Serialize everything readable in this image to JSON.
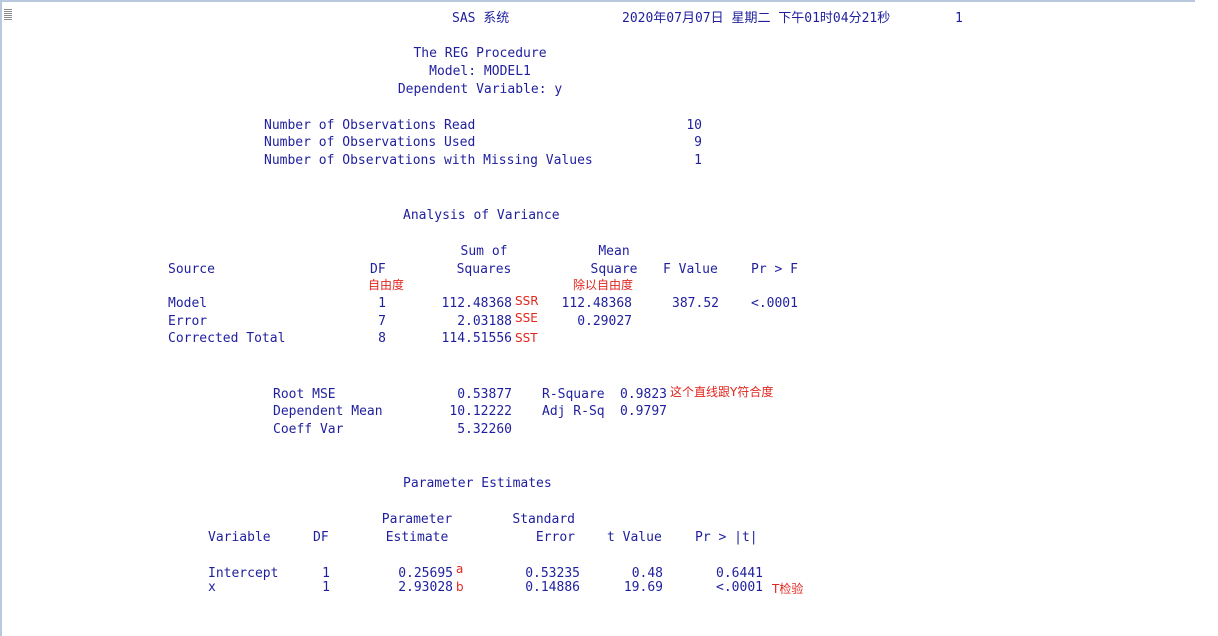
{
  "header": {
    "system_title": "SAS 系统",
    "datetime": "2020年07月07日 星期二 下午01时04分21秒",
    "page_number": "1"
  },
  "procedure": {
    "title": "The REG Procedure",
    "model": "Model: MODEL1",
    "dependent": "Dependent Variable: y"
  },
  "observations": [
    {
      "label": "Number of Observations Read",
      "value": "10"
    },
    {
      "label": "Number of Observations Used",
      "value": "9"
    },
    {
      "label": "Number of Observations with Missing Values",
      "value": "1"
    }
  ],
  "anova": {
    "title": "Analysis of Variance",
    "headers": {
      "source": "Source",
      "df": "DF",
      "ss_top": "Sum of",
      "ss_bottom": "Squares",
      "ms_top": "Mean",
      "ms_bottom": "Square",
      "f": "F Value",
      "p": "Pr > F"
    },
    "rows": [
      {
        "source": "Model",
        "df": "1",
        "ss": "112.48368",
        "ms": "112.48368",
        "f": "387.52",
        "p": "<.0001"
      },
      {
        "source": "Error",
        "df": "7",
        "ss": "2.03188",
        "ms": "0.29027",
        "f": "",
        "p": ""
      },
      {
        "source": "Corrected Total",
        "df": "8",
        "ss": "114.51556",
        "ms": "",
        "f": "",
        "p": ""
      }
    ]
  },
  "fit": {
    "left": [
      {
        "label": "Root MSE",
        "value": "0.53877"
      },
      {
        "label": "Dependent Mean",
        "value": "10.12222"
      },
      {
        "label": "Coeff Var",
        "value": "5.32260"
      }
    ],
    "right": [
      {
        "label": "R-Square",
        "value": "0.9823"
      },
      {
        "label": "Adj R-Sq",
        "value": "0.9797"
      }
    ]
  },
  "params": {
    "title": "Parameter Estimates",
    "headers": {
      "variable": "Variable",
      "df": "DF",
      "est_top": "Parameter",
      "est_bottom": "Estimate",
      "se_top": "Standard",
      "se_bottom": "Error",
      "t": "t Value",
      "p": "Pr > |t|"
    },
    "rows": [
      {
        "variable": "Intercept",
        "df": "1",
        "estimate": "0.25695",
        "se": "0.53235",
        "t": "0.48",
        "p": "0.6441"
      },
      {
        "variable": "x",
        "df": "1",
        "estimate": "2.93028",
        "se": "0.14886",
        "t": "19.69",
        "p": "<.0001"
      }
    ]
  },
  "annotations": {
    "df": "自由度",
    "ms": "除以自由度",
    "ssr": "SSR",
    "sse": "SSE",
    "sst": "SST",
    "rsq": "这个直线跟Y符合度",
    "a": "a",
    "b": "b",
    "ttest": "T检验"
  }
}
